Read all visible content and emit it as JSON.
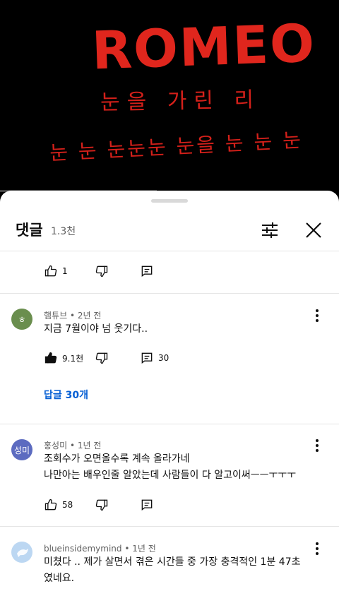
{
  "video": {
    "title_art": "ROMEO",
    "line2": "눈을 가린 리",
    "line3": "눈 눈 눈눈눈 눈을 눈 눈 눈"
  },
  "header": {
    "title": "댓글",
    "count": "1.3천"
  },
  "comments": [
    {
      "likes": "1"
    },
    {
      "author": "햄튜브",
      "time": "2년 전",
      "text": "지금 7월이야 넘 웃기다..",
      "likes": "9.1천",
      "replies_count": "30",
      "replies_label": "답글 30개",
      "avatar_char": "ㅎ",
      "avatar_color": "#6a8e4e"
    },
    {
      "author": "홍성미",
      "time": "1년 전",
      "text": "조회수가 오면올수록  계속 올라가네\n나만아는 배우인줄  알았는데 사람들이  다 알고이써ㅡㅡㅜㅜㅜ",
      "likes": "58",
      "avatar_char": "성미",
      "avatar_color": "#5c6bc0"
    },
    {
      "author": "blueinsidemymind",
      "time": "1년 전",
      "text": "미쳤다 .. 제가 살면서 겪은 시간들 중 가장 충격적인 1분 47초\n였네요.",
      "avatar_char": "",
      "avatar_color": "#bcd7f2"
    }
  ],
  "separator": "•"
}
